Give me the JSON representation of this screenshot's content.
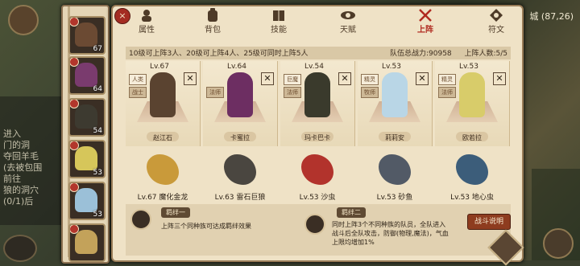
{
  "background": {
    "left_text_lines": [
      "进入",
      "门的洞",
      "夺回羊毛",
      "(去被包围",
      "前往",
      "狼的洞穴",
      "(0/1)后"
    ],
    "coords": "城 (87,26)"
  },
  "tabs": [
    {
      "label": "属性",
      "icon": "attribute-icon"
    },
    {
      "label": "背包",
      "icon": "backpack-icon"
    },
    {
      "label": "技能",
      "icon": "skill-book-icon"
    },
    {
      "label": "天赋",
      "icon": "talent-icon"
    },
    {
      "label": "上阵",
      "icon": "crossed-swords-icon",
      "active": true
    },
    {
      "label": "符文",
      "icon": "rune-icon"
    }
  ],
  "close_label": "×",
  "info": {
    "rule": "10级可上阵3人、20级可上阵4人、25级可同时上阵5人",
    "power": "队伍总战力:90958",
    "count": "上阵人数:5/5"
  },
  "left_column": [
    {
      "level": "67",
      "color": "#6b4a33"
    },
    {
      "level": "64",
      "color": "#7a3b6e"
    },
    {
      "level": "54",
      "color": "#3d3a30"
    },
    {
      "level": "53",
      "color": "#d6c65a"
    },
    {
      "level": "53",
      "color": "#9bc0d8"
    },
    {
      "level": "",
      "color": "#c3a25a"
    }
  ],
  "lineup": [
    {
      "level": "Lv.67",
      "tag1": "人类",
      "tag2": "战士",
      "name": "赵江石",
      "color": "#5a4330"
    },
    {
      "level": "Lv.64",
      "tag1": "",
      "tag2": "法师",
      "name": "卡蜜拉",
      "color": "#6d2e62"
    },
    {
      "level": "Lv.54",
      "tag1": "巨魔",
      "tag2": "法师",
      "name": "玛卡巴卡",
      "color": "#3a3a2c"
    },
    {
      "level": "Lv.53",
      "tag1": "精灵",
      "tag2": "牧师",
      "name": "莉莉安",
      "color": "#b9d6e6"
    },
    {
      "level": "Lv.53",
      "tag1": "精灵",
      "tag2": "法师",
      "name": "欧若拉",
      "color": "#d8cc6a"
    }
  ],
  "pets": [
    {
      "label": "Lv.67 魔化金龙",
      "color": "#c99a3a"
    },
    {
      "label": "Lv.63 雷石巨狼",
      "color": "#4a4640"
    },
    {
      "label": "Lv.53 沙虫",
      "color": "#b2332c"
    },
    {
      "label": "Lv.53 砂鱼",
      "color": "#525a66"
    },
    {
      "label": "Lv.53 地心虫",
      "color": "#3c5d7a"
    }
  ],
  "bonds": [
    {
      "title": "羁绊一",
      "desc": "上阵三个同种族可达成羁绊效果"
    },
    {
      "title": "羁绊二",
      "desc_lines": [
        "同时上阵3个不同种族的队员，全队进入",
        "战斗后全队攻击，防御(物理,魔法)，气血",
        "上限均增加1%"
      ]
    }
  ],
  "battle_button": "战斗说明"
}
